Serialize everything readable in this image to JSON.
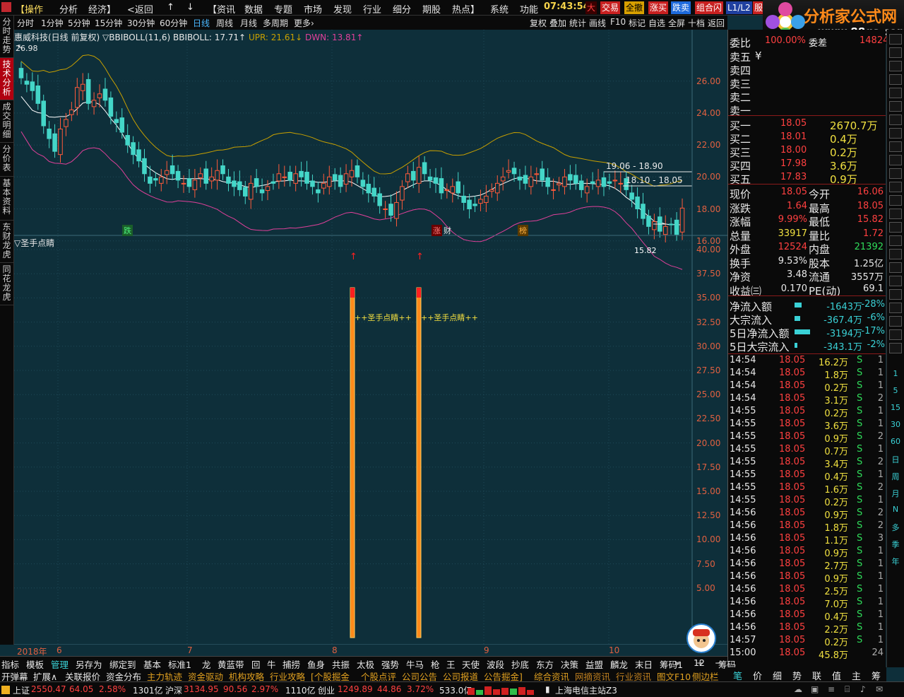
{
  "menu": {
    "items": [
      "【操作",
      "分析",
      "经济】",
      "<返回",
      "↑",
      "↓",
      "【资讯",
      "数据",
      "专题",
      "市场",
      "发现",
      "行业",
      "细分",
      "期股",
      "热点】",
      "系统",
      "功能"
    ],
    "clock": "07:43:54",
    "big": "大",
    "buttons": [
      "交易",
      "全撤",
      "涨买",
      "跌卖",
      "组合闪",
      "L1/L2",
      "服"
    ]
  },
  "watermark": {
    "title": "分析家公式网",
    "url": "www.88gs.com"
  },
  "periods": {
    "items": [
      "分时",
      "1分钟",
      "5分钟",
      "15分钟",
      "30分钟",
      "60分钟",
      "日线",
      "周线",
      "月线",
      "多周期",
      "更多›"
    ],
    "active": "日线"
  },
  "chart_tools": [
    "复权",
    "叠加",
    "统计",
    "画线",
    "F10",
    "标记",
    "自选",
    "全屏",
    "十档",
    "返回"
  ],
  "left_tabs": [
    "分时走势",
    "技术分析",
    "成交明细",
    "分价表",
    "基本资料",
    "东财龙虎",
    "同花龙虎"
  ],
  "main": {
    "title": "惠威科技(日线 前复权)",
    "ind": "▽BBIBOLL(11,6)",
    "bbiboll": "BBIBOLL: 17.71↑",
    "upr": "UPR: 21.61↓",
    "dwn": "DWN: 13.81↑",
    "high_label": "26.98",
    "y_ticks": [
      "26.00",
      "24.00",
      "22.00",
      "20.00",
      "18.00",
      "16.00"
    ],
    "low_label": "15.82",
    "ann1": "19.06 - 18.90",
    "ann2": "18.10 - 18.05",
    "tags": [
      "跌",
      "涨",
      "财",
      "榜"
    ]
  },
  "sub": {
    "title": "▽圣手点睛",
    "y_ticks": [
      "40.00",
      "37.50",
      "35.00",
      "32.50",
      "30.00",
      "27.50",
      "25.00",
      "22.50",
      "20.00",
      "17.50",
      "15.00",
      "12.50",
      "10.00",
      "7.50",
      "5.00"
    ],
    "signal_label": "++圣手点睛++"
  },
  "xaxis": [
    "2018年",
    "6",
    "7",
    "8",
    "9",
    "10"
  ],
  "quote": {
    "weibi": "委比",
    "weibi_val": "100.00%",
    "weicha": "委差",
    "weicha_val": "14824",
    "asks": [
      {
        "l": "卖五",
        "p": "¥",
        "v": ""
      },
      {
        "l": "卖四",
        "p": "",
        "v": ""
      },
      {
        "l": "卖三",
        "p": "",
        "v": ""
      },
      {
        "l": "卖二",
        "p": "",
        "v": ""
      },
      {
        "l": "卖一",
        "p": "",
        "v": ""
      }
    ],
    "bids": [
      {
        "l": "买一",
        "p": "18.05",
        "v": "2670.7万"
      },
      {
        "l": "买二",
        "p": "18.01",
        "v": "0.4万"
      },
      {
        "l": "买三",
        "p": "18.00",
        "v": "0.2万"
      },
      {
        "l": "买四",
        "p": "17.98",
        "v": "3.6万"
      },
      {
        "l": "买五",
        "p": "17.83",
        "v": "0.9万"
      }
    ],
    "stats": [
      {
        "a": "现价",
        "av": "18.05",
        "b": "今开",
        "bv": "16.06"
      },
      {
        "a": "涨跌",
        "av": "1.64",
        "b": "最高",
        "bv": "18.05"
      },
      {
        "a": "涨幅",
        "av": "9.99%",
        "b": "最低",
        "bv": "15.82"
      },
      {
        "a": "总量",
        "av": "33917",
        "b": "量比",
        "bv": "1.72"
      },
      {
        "a": "外盘",
        "av": "12524",
        "b": "内盘",
        "bv": "21392"
      },
      {
        "a": "换手",
        "av": "9.53%",
        "b": "股本",
        "bv": "1.25亿"
      },
      {
        "a": "净资",
        "av": "3.48",
        "b": "流通",
        "bv": "3557万"
      },
      {
        "a": "收益㈢",
        "av": "0.170",
        "b": "PE(动)",
        "bv": "69.1"
      }
    ],
    "flows": [
      {
        "l": "净流入额",
        "v": "-1643万",
        "p": "-28%"
      },
      {
        "l": "大宗流入",
        "v": "-367.4万",
        "p": "-6%"
      },
      {
        "l": "5日净流入额",
        "v": "-3194万",
        "p": "-17%"
      },
      {
        "l": "5日大宗流入",
        "v": "-343.1万",
        "p": "-2%"
      }
    ],
    "ticks": [
      [
        "14:54",
        "18.05",
        "16.2万",
        "S",
        "1"
      ],
      [
        "14:54",
        "18.05",
        "1.8万",
        "S",
        "1"
      ],
      [
        "14:54",
        "18.05",
        "0.2万",
        "S",
        "1"
      ],
      [
        "14:54",
        "18.05",
        "3.1万",
        "S",
        "2"
      ],
      [
        "14:55",
        "18.05",
        "0.2万",
        "S",
        "1"
      ],
      [
        "14:55",
        "18.05",
        "3.6万",
        "S",
        "1"
      ],
      [
        "14:55",
        "18.05",
        "0.9万",
        "S",
        "2"
      ],
      [
        "14:55",
        "18.05",
        "0.7万",
        "S",
        "1"
      ],
      [
        "14:55",
        "18.05",
        "3.4万",
        "S",
        "2"
      ],
      [
        "14:55",
        "18.05",
        "0.4万",
        "S",
        "1"
      ],
      [
        "14:55",
        "18.05",
        "1.6万",
        "S",
        "2"
      ],
      [
        "14:55",
        "18.05",
        "0.2万",
        "S",
        "1"
      ],
      [
        "14:56",
        "18.05",
        "0.9万",
        "S",
        "2"
      ],
      [
        "14:56",
        "18.05",
        "1.8万",
        "S",
        "2"
      ],
      [
        "14:56",
        "18.05",
        "1.1万",
        "S",
        "3"
      ],
      [
        "14:56",
        "18.05",
        "0.9万",
        "S",
        "1"
      ],
      [
        "14:56",
        "18.05",
        "2.7万",
        "S",
        "1"
      ],
      [
        "14:56",
        "18.05",
        "0.9万",
        "S",
        "1"
      ],
      [
        "14:56",
        "18.05",
        "2.5万",
        "S",
        "1"
      ],
      [
        "14:56",
        "18.05",
        "7.0万",
        "S",
        "1"
      ],
      [
        "14:56",
        "18.05",
        "0.4万",
        "S",
        "1"
      ],
      [
        "14:56",
        "18.05",
        "2.2万",
        "S",
        "1"
      ],
      [
        "14:57",
        "18.05",
        "0.2万",
        "S",
        "1"
      ],
      [
        "15:00",
        "18.05",
        "45.8万",
        "",
        "24"
      ]
    ]
  },
  "tools": [
    "1",
    "5",
    "15",
    "30",
    "60",
    "日",
    "周",
    "月",
    "N",
    "多",
    "季",
    "年"
  ],
  "indicator_bar": [
    "指标",
    "模板",
    "管理",
    "另存为",
    "绑定到",
    "基本",
    "标准1",
    "龙",
    "黄蓝带",
    "回",
    "牛",
    "捕捞",
    "鱼身",
    "共振",
    "太极",
    "强势",
    "牛马",
    "枪",
    "王",
    "天使",
    "波段",
    "抄底",
    "东方",
    "决策",
    "益盟",
    "麟龙",
    "末日",
    "筹码1",
    "12",
    "筹码"
  ],
  "info_bar": [
    "开弹幕",
    "扩展∧",
    "关联报价",
    "资金分布",
    "主力轨迹",
    "资金驱动",
    "机构攻略",
    "行业攻略",
    "[个股掘金",
    "个股点评",
    "公司公告",
    "公司报道",
    "公告掘金]",
    "综合资讯",
    "网摘资讯",
    "行业资讯"
  ],
  "info_right": [
    "图文F10",
    "侧边栏"
  ],
  "right_tabs": [
    "笔",
    "价",
    "细",
    "势",
    "联",
    "值",
    "主",
    "筹"
  ],
  "status": {
    "sh": "上证",
    "sh_v": "2550.47",
    "sh_c": "64.05",
    "sh_p": "2.58%",
    "sh_a": "1301亿",
    "sz": "沪深",
    "sz_v": "3134.95",
    "sz_c": "90.56",
    "sz_p": "2.97%",
    "sz_a": "1110亿",
    "cy": "创业",
    "cy_v": "1249.89",
    "cy_c": "44.86",
    "cy_p": "3.72%",
    "cy_a": "533.0亿",
    "server": "上海电信主站Z3"
  }
}
